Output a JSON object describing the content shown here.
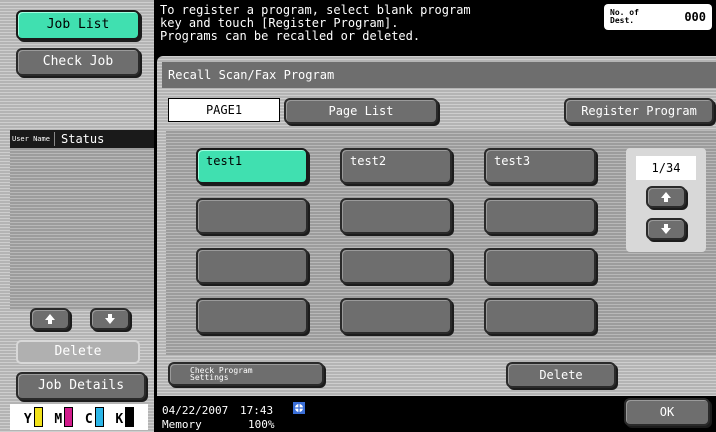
{
  "sidebar": {
    "job_list": "Job List",
    "check_job": "Check Job",
    "user_name_header": "User Name",
    "status_header": "Status",
    "delete": "Delete",
    "job_details": "Job Details",
    "toner": [
      {
        "letter": "Y",
        "color": "#f2e21a"
      },
      {
        "letter": "M",
        "color": "#d21c8c"
      },
      {
        "letter": "C",
        "color": "#2bb6e8"
      },
      {
        "letter": "K",
        "color": "#000000"
      }
    ]
  },
  "message": {
    "line1": "To register a program, select blank program",
    "line2": "key and touch [Register Program].",
    "line3": "Programs can be recalled or deleted."
  },
  "dest_counter": {
    "label": "No. of Dest.",
    "value": "000"
  },
  "panel": {
    "title": "Recall Scan/Fax Program",
    "tab_page1": "PAGE1",
    "tab_page_list": "Page List",
    "register_program": "Register Program",
    "programs": [
      "test1",
      "test2",
      "test3",
      "",
      "",
      "",
      "",
      "",
      "",
      "",
      "",
      ""
    ],
    "page_indicator": "1/34",
    "check_program_settings": "Check Program Settings",
    "delete": "Delete"
  },
  "status_bar": {
    "date": "04/22/2007",
    "time": "17:43",
    "memory_label": "Memory",
    "memory_value": "100%"
  },
  "ok": "OK",
  "colors": {
    "accent_teal": "#40e0b0",
    "panel_grey": "#b4b4b4",
    "button_grey": "#6e6e6e"
  }
}
